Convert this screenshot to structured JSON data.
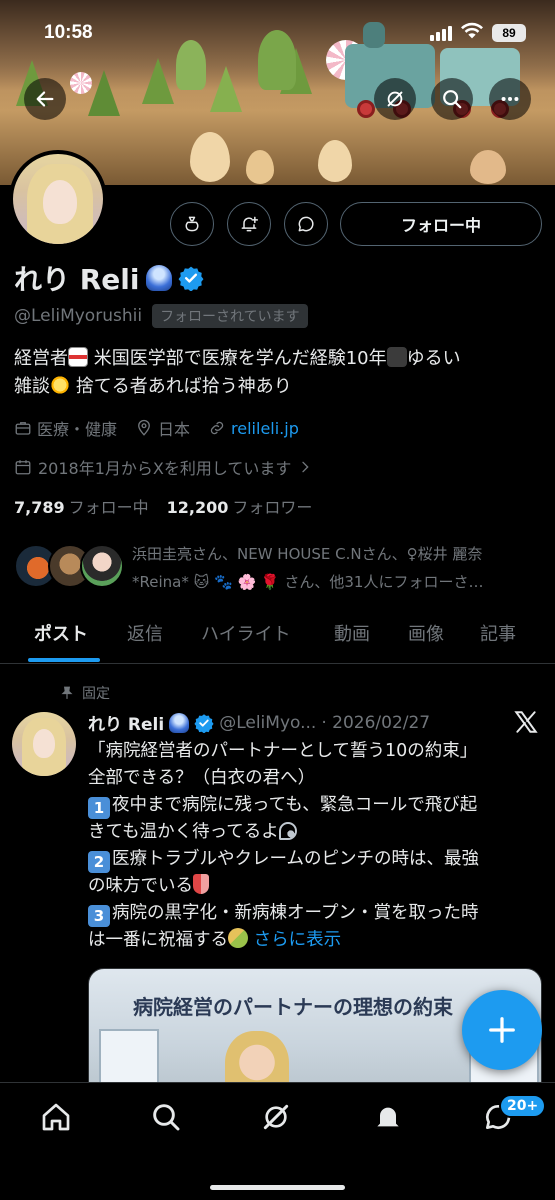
{
  "status_bar": {
    "time": "10:58",
    "battery": "89"
  },
  "header": {
    "back_icon": "arrow-left-icon",
    "grok_icon": "grok-icon",
    "search_icon": "search-icon",
    "more_icon": "more-horizontal-icon"
  },
  "profile": {
    "name": "れり Reli",
    "handle": "@LeliMyorushii",
    "follows_you": "フォローされています",
    "follow_button": "フォロー中",
    "bio_line1_a": "経営者",
    "bio_line1_b": "米国医学部で医療を学んだ経験10年",
    "bio_line1_c": "ゆるい",
    "bio_line2_a": "雑談",
    "bio_line2_b": "捨てる者あれば拾う神あり",
    "category": "医療・健康",
    "location": "日本",
    "website": "relileli.jp",
    "joined": "2018年1月からXを利用しています",
    "following_count": "7,789",
    "following_label": "フォロー中",
    "followers_count": "12,200",
    "followers_label": "フォロワー",
    "followed_by_line1": "浜田圭亮さん、NEW HOUSE C.Nさん、♀桜井 麗奈",
    "followed_by_line2": "*Reina* 🐱 🐾 🌸 🌹 さん、他31人にフォローさ…"
  },
  "tabs": [
    "ポスト",
    "返信",
    "ハイライト",
    "動画",
    "画像",
    "記事"
  ],
  "post": {
    "pinned_label": "固定",
    "author_name": "れり Reli",
    "author_handle": "@LeliMyo...",
    "date": "· 2026/02/27",
    "line1": "「病院経営者のパートナーとして誓う10の約束」",
    "line2": "全部できる？（白衣の君へ）",
    "item1_num": "1",
    "item1_a": "夜中まで病院に残っても、緊急コールで飛び起",
    "item1_b": "きても温かく待ってるよ",
    "item2_num": "2",
    "item2_a": "医療トラブルやクレームのピンチの時は、最強",
    "item2_b": "の味方でいる",
    "item3_num": "3",
    "item3_a": "病院の黒字化・新病棟オープン・賞を取った時",
    "item3_b": "は一番に祝福する",
    "show_more": "さらに表示",
    "image_title": "病院経営のパートナーの理想の約束"
  },
  "bottom_nav": {
    "items": [
      "home-icon",
      "search-icon",
      "grok-icon",
      "notifications-icon",
      "messages-icon"
    ],
    "messages_badge": "20+"
  },
  "colors": {
    "accent": "#1d9bf0",
    "background": "#000000",
    "secondary_text": "#71767b"
  }
}
